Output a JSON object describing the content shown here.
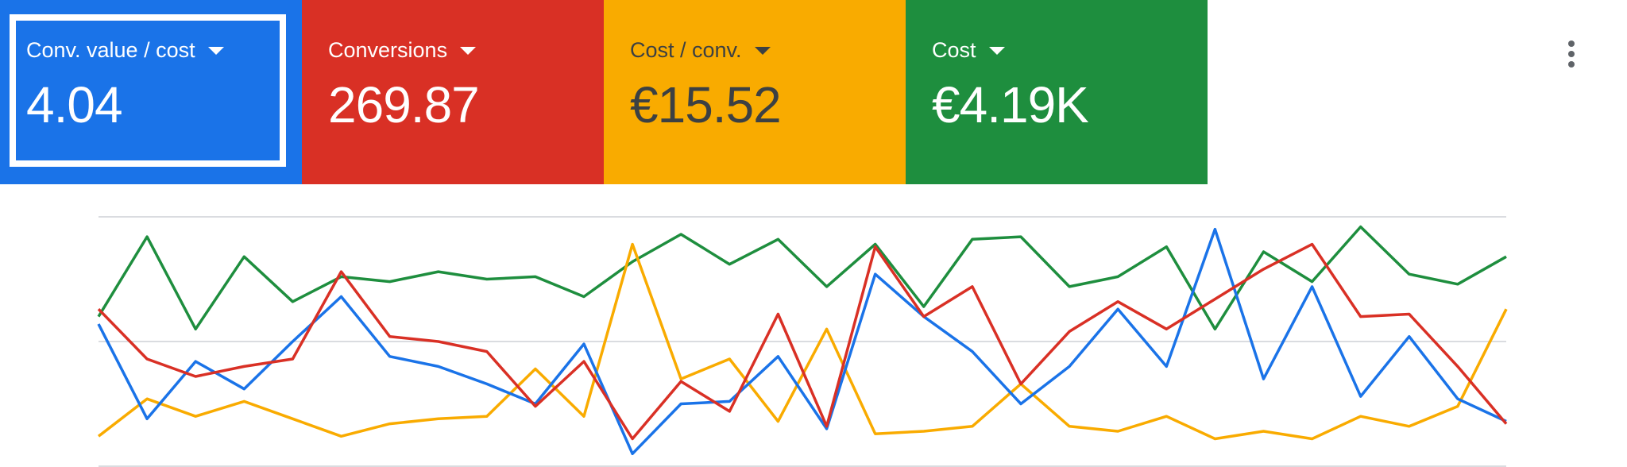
{
  "tiles": [
    {
      "label": "Conv. value / cost",
      "value": "4.04",
      "color": "#1a73e8",
      "text_color": "#ffffff",
      "selected": true
    },
    {
      "label": "Conversions",
      "value": "269.87",
      "color": "#d93025",
      "text_color": "#ffffff",
      "selected": false
    },
    {
      "label": "Cost / conv.",
      "value": "€15.52",
      "color": "#f9ab00",
      "text_color": "#3c4043",
      "selected": false
    },
    {
      "label": "Cost",
      "value": "€4.19K",
      "color": "#1e8e3e",
      "text_color": "#ffffff",
      "selected": false
    }
  ],
  "menu_icon": "more-vert-icon",
  "chart_data": {
    "type": "line",
    "x": [
      1,
      2,
      3,
      4,
      5,
      6,
      7,
      8,
      9,
      10,
      11,
      12,
      13,
      14,
      15,
      16,
      17,
      18,
      19,
      20,
      21,
      22,
      23,
      24,
      25,
      26,
      27,
      28,
      29,
      30
    ],
    "ylim": [
      0,
      100
    ],
    "grid": true,
    "gridlines": [
      0,
      50,
      100
    ],
    "series": [
      {
        "color": "#1a73e8",
        "values": [
          57,
          19,
          42,
          31,
          50,
          68,
          44,
          40,
          33,
          25,
          49,
          5,
          25,
          26,
          44,
          15,
          77,
          60,
          46,
          25,
          40,
          63,
          40,
          95,
          35,
          72,
          28,
          52,
          27,
          18
        ]
      },
      {
        "color": "#d93025",
        "values": [
          63,
          43,
          36,
          40,
          43,
          78,
          52,
          50,
          46,
          24,
          42,
          11,
          34,
          22,
          61,
          16,
          88,
          60,
          72,
          33,
          54,
          66,
          55,
          67,
          79,
          89,
          60,
          61,
          40,
          17
        ]
      },
      {
        "color": "#f9ab00",
        "values": [
          12,
          27,
          20,
          26,
          19,
          12,
          17,
          19,
          20,
          39,
          20,
          89,
          35,
          43,
          18,
          55,
          13,
          14,
          16,
          33,
          16,
          14,
          20,
          11,
          14,
          11,
          20,
          16,
          24,
          63
        ]
      },
      {
        "color": "#1e8e3e",
        "values": [
          60,
          92,
          55,
          84,
          66,
          76,
          74,
          78,
          75,
          76,
          68,
          82,
          93,
          81,
          91,
          72,
          89,
          64,
          91,
          92,
          72,
          76,
          88,
          55,
          86,
          74,
          96,
          77,
          73,
          84
        ]
      }
    ]
  }
}
